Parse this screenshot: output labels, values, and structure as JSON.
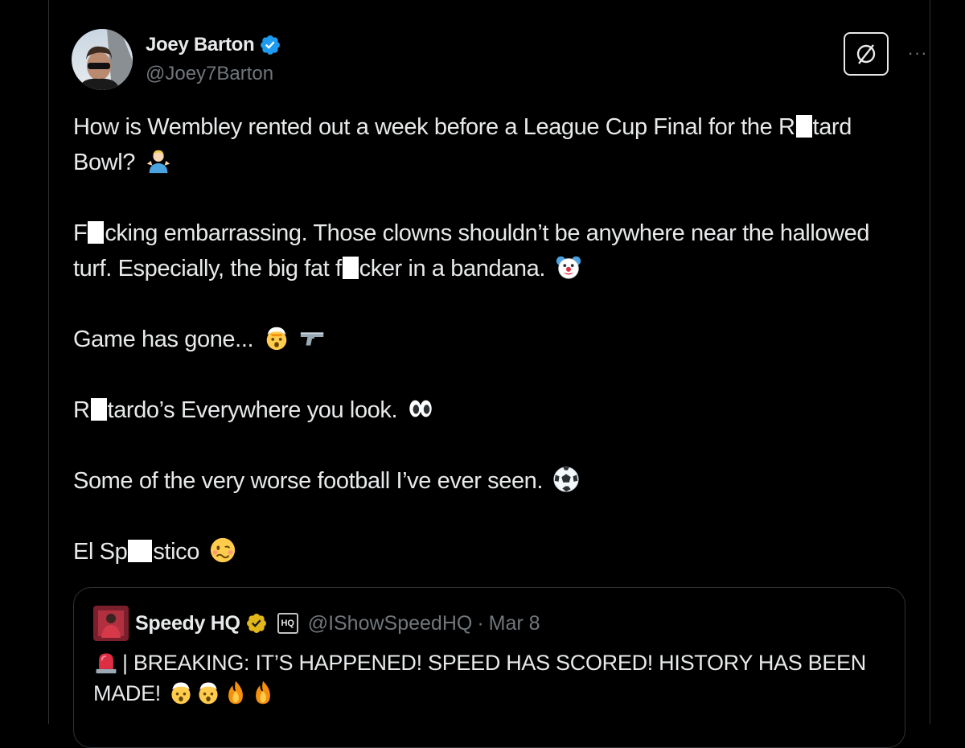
{
  "author": {
    "name": "Joey Barton",
    "handle": "@Joey7Barton",
    "verified": true
  },
  "actions": {
    "grok_icon": "grok-icon",
    "more_label": "···"
  },
  "tweet": {
    "p1": {
      "pre": "How is Wembley rented out a week before a League Cup Final for the R",
      "post": "tard Bowl?",
      "emoji": "person-shrugging"
    },
    "p2": {
      "pre": "F",
      "mid": "cking embarrassing. Those clowns shouldn’t be anywhere near the hallowed turf. Especially, the big fat f",
      "post": "cker in a bandana.",
      "emoji": "clown-face"
    },
    "p3": {
      "text": "Game has gone...",
      "emoji1": "exploding-head",
      "emoji2": "pistol"
    },
    "p4": {
      "pre": "R",
      "post": "tardo’s Everywhere you look.",
      "emoji": "eyes"
    },
    "p5": {
      "text": "Some of the very worse football I’ve ever seen.",
      "emoji": "soccer-ball"
    },
    "p6": {
      "pre": "El Sp",
      "post": "stico",
      "emoji": "woozy-face"
    }
  },
  "quote": {
    "name": "Speedy HQ",
    "org_badge": "HQ",
    "handle": "@IShowSpeedHQ",
    "separator": "·",
    "date": "Mar 8",
    "text": "| BREAKING: IT’S HAPPENED! SPEED HAS SCORED! HISTORY HAS BEEN MADE!",
    "emojis": [
      "police-light",
      "exploding-head",
      "exploding-head",
      "fire",
      "fire"
    ]
  },
  "colors": {
    "background": "#000000",
    "text": "#e7e9ea",
    "secondary": "#71767b",
    "border": "#2f3336",
    "verified_blue": "#1d9bf0",
    "verified_gold": "#e2b719"
  }
}
